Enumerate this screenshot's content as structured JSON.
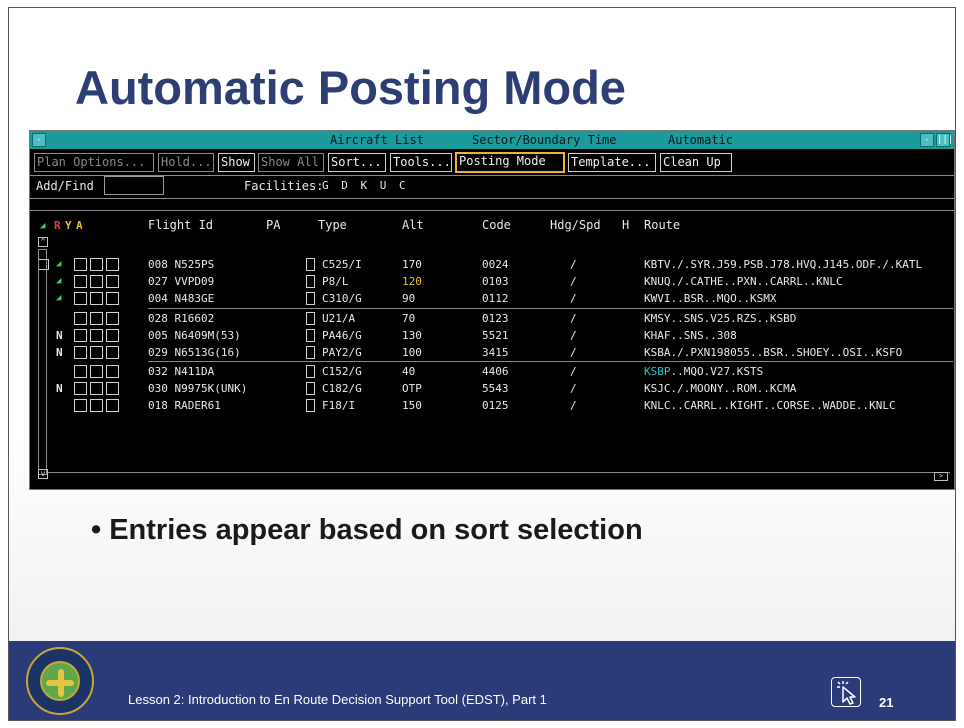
{
  "slide": {
    "title": "Automatic Posting Mode",
    "bullet_marker": "•",
    "bullet": "Entries appear based on sort selection"
  },
  "window": {
    "titlebar": {
      "left_btn": "-",
      "right_btn_1": "-",
      "right_btn_2": "|||",
      "list_name": "Aircraft List",
      "sort_mode": "Sector/Boundary Time",
      "posting_mode": "Automatic"
    },
    "toolbar": {
      "plan_options": "Plan Options...",
      "hold": "Hold...",
      "show": "Show",
      "show_all": "Show All",
      "sort": "Sort...",
      "tools": "Tools...",
      "posting_mode": "Posting Mode",
      "template": "Template...",
      "clean_up": "Clean Up"
    },
    "add_find_label": "Add/Find",
    "add_find_value": "",
    "facilities_label": "Facilities:",
    "facilities_value": "G D K U C",
    "columns": {
      "r": "R",
      "y": "Y",
      "a": "A",
      "flight_id": "Flight Id",
      "pa": "PA",
      "type": "Type",
      "alt": "Alt",
      "code": "Code",
      "hdg_spd": "Hdg/Spd",
      "h": "H",
      "route": "Route"
    },
    "rows": [
      {
        "flag": "",
        "flight": "008 N525PS",
        "type": "C525/I",
        "alt": "170",
        "code": "0024",
        "hdg": "/",
        "route": "KBTV./.SYR.J59.PSB.J78.HVQ.J145.ODF./.KATL",
        "route_prefix": ""
      },
      {
        "flag": "",
        "flight": "027 VVPD09",
        "type": "P8/L",
        "alt": "120",
        "code": "0103",
        "hdg": "/",
        "route": "KNUQ./.CATHE..PXN..CARRL..KNLC",
        "route_prefix": ""
      },
      {
        "flag": "",
        "flight": "004 N483GE",
        "type": "C310/G",
        "alt": "90",
        "code": "0112",
        "hdg": "/",
        "route": "KWVI..BSR..MQO..KSMX",
        "route_prefix": ""
      },
      {
        "flag": "",
        "flight": "028 R16602",
        "type": "U21/A",
        "alt": "70",
        "code": "0123",
        "hdg": "/",
        "route": "KMSY..SNS.V25.RZS..KSBD",
        "route_prefix": ""
      },
      {
        "flag": "N",
        "flight": "005 N6409M(53)",
        "type": "PA46/G",
        "alt": "130",
        "code": "5521",
        "hdg": "/",
        "route": "KHAF..SNS..308",
        "route_prefix": ""
      },
      {
        "flag": "N",
        "flight": "029 N6513G(16)",
        "type": "PAY2/G",
        "alt": "100",
        "code": "3415",
        "hdg": "/",
        "route": "KSBA./.PXN198055..BSR..SHOEY..OSI..KSFO",
        "route_prefix": ""
      },
      {
        "flag": "",
        "flight": "032 N411DA",
        "type": "C152/G",
        "alt": "40",
        "code": "4406",
        "hdg": "/",
        "route": "..MQO.V27.KSTS",
        "route_prefix": "KSBP"
      },
      {
        "flag": "N",
        "flight": "030 N9975K(UNK)",
        "type": "C182/G",
        "alt": "OTP",
        "code": "5543",
        "hdg": "/",
        "route": "KSJC./.MOONY..ROM..KCMA",
        "route_prefix": ""
      },
      {
        "flag": "",
        "flight": "018 RADER61",
        "type": "F18/I",
        "alt": "150",
        "code": "0125",
        "hdg": "/",
        "route": "KNLC..CARRL..KIGHT..CORSE..WADDE..KNLC",
        "route_prefix": ""
      }
    ]
  },
  "footer": {
    "lesson": "Lesson 2: Introduction to En Route Decision Support Tool (EDST), Part 1",
    "page": "21"
  },
  "colors": {
    "title": "#2d3e75",
    "titlebar": "#1a9a9a",
    "highlight": "#f2b12d",
    "alt_highlight": "#e6c12a",
    "route_highlight": "#27c4c4",
    "marker": "#3bd15e",
    "footer": "#2b3b78"
  },
  "icons": {
    "cursor": "cursor-click-icon",
    "seal": "faa-seal-icon",
    "marker": "posting-marker-icon"
  }
}
